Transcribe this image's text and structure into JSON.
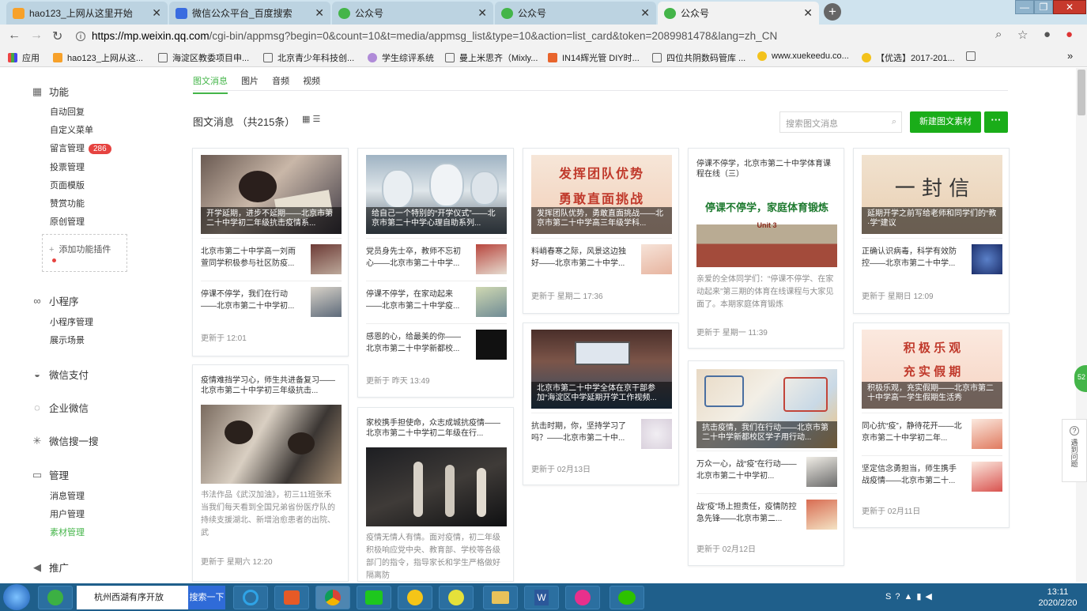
{
  "browser": {
    "tabs": [
      {
        "label": "hao123_上网从这里开始",
        "active": false
      },
      {
        "label": "微信公众平台_百度搜索",
        "active": false
      },
      {
        "label": "公众号",
        "active": false
      },
      {
        "label": "公众号",
        "active": false
      },
      {
        "label": "公众号",
        "active": true
      }
    ],
    "url_host": "https://mp.weixin.qq.com",
    "url_rest": "/cgi-bin/appmsg?begin=0&count=10&t=media/appmsg_list&type=10&action=list_card&token=2089981478&lang=zh_CN",
    "bookmarks": [
      "应用",
      "hao123_上网从这...",
      "海淀区教委项目申...",
      "北京青少年科技创...",
      "学生综评系统",
      "曼上米思齐（Mixly...",
      "IN14辉光管 DIY时...",
      "四位共阴数码管库 ...",
      "www.xuekeedu.co...",
      "【优选】2017-201..."
    ],
    "bookmarks_more": "»"
  },
  "sidebar": {
    "sections": [
      {
        "label": "功能",
        "icon": "grid-icon",
        "items": [
          {
            "label": "自动回复"
          },
          {
            "label": "自定义菜单"
          },
          {
            "label": "留言管理",
            "badge": "286"
          },
          {
            "label": "投票管理"
          },
          {
            "label": "页面模版"
          },
          {
            "label": "赞赏功能"
          },
          {
            "label": "原创管理"
          }
        ]
      },
      {
        "label": "小程序",
        "icon": "link-icon",
        "items": [
          {
            "label": "小程序管理"
          },
          {
            "label": "展示场景"
          }
        ]
      },
      {
        "label": "微信支付",
        "icon": "pay-icon",
        "items": []
      },
      {
        "label": "企业微信",
        "icon": "work-icon",
        "items": []
      },
      {
        "label": "微信搜一搜",
        "icon": "search-star-icon",
        "items": []
      },
      {
        "label": "管理",
        "icon": "manage-icon",
        "items": [
          {
            "label": "消息管理"
          },
          {
            "label": "用户管理"
          },
          {
            "label": "素材管理"
          }
        ]
      },
      {
        "label": "推广",
        "icon": "promo-icon",
        "items": []
      }
    ],
    "plugin_label": "添加功能插件",
    "active_item": "素材管理"
  },
  "main": {
    "tabs": [
      "图文消息",
      "图片",
      "音频",
      "视频"
    ],
    "page_title": "图文消息 （共215条）",
    "search_placeholder": "搜索图文消息",
    "new_button": "新建图文素材",
    "more_button": "···"
  },
  "cards": [
    {
      "cover": "开学延期，进步不延期——北京市第二十中学初二年级抗击疫情系...",
      "items": [
        "北京市第二十中学高一刘雨萱同学积极参与社区防疫...",
        "停课不停学，我们在行动——北京市第二十中学初..."
      ],
      "updated": "更新于 12:01"
    },
    {
      "title": "疫情难挡学习心，师生共进备复习——北京市第二十中学初三年级抗击...",
      "desc": "书法作品《武汉加油》，初三11班张禾 当我们每天看到全国兄弟省份医疗队的持续支援湖北、新增治愈患者的出院、武",
      "updated": "更新于 星期六 12:20"
    },
    {
      "cover": "给自己一个特别的“开学仪式”——北京市第二十中学心理自助系列...",
      "items": [
        "党员身先士卒，教师不忘初心——北京市第二十中学...",
        "停课不停学，在家动起来——北京市第二十中学疫...",
        "感恩的心，给最美的你——北京市第二十中学新都校..."
      ],
      "updated": "更新于 昨天 13:49"
    },
    {
      "title": "家校携手担使命，众志成城抗疫情——北京市第二十中学初二年级在行...",
      "desc": "疫情无情人有情。面对疫情，初二年级积极响应党中央、教育部、学校等各级部门的指令，指导家长和学生严格做好隔离防",
      "updated": ""
    },
    {
      "cover": "发挥团队优势，勇敢直面挑战——北京市第二十中学高三年级学科...",
      "cover_text": [
        "发挥团队优势",
        "勇敢直面挑战"
      ],
      "items": [
        "料峭春寒之际，风景这边独好——北京市第二十中学..."
      ],
      "updated": "更新于 星期二 17:36"
    },
    {
      "cover": "北京市第二十中学全体在京干部参加“海淀区中学延期开学工作视频...",
      "items": [
        "抗击时期，你，坚持学习了吗？——北京市第二十中..."
      ],
      "updated": "更新于 02月13日"
    },
    {
      "title": "停课不停学，北京市第二十中学体育课程在线（三）",
      "pic_text": "停课不停学，家庭体育锻炼",
      "pic_sub": "Unit 3",
      "desc": "亲爱的全体同学们：“停课不停学、在家动起来”第三期的体育在线课程与大家见面了。本期家庭体育锻炼",
      "updated": "更新于 星期一 11:39"
    },
    {
      "cover": "抗击疫情，我们在行动——北京市第二十中学新都校区学子用行动...",
      "items": [
        "万众一心，战“疫”在行动——北京市第二十中学初...",
        "战“疫”场上担责任，疫情防控急先锋——北京市第二..."
      ],
      "updated": "更新于 02月12日"
    },
    {
      "cover": "延期开学之前写给老师和同学们的“教·学”建议",
      "cover_text": [
        "一 封 信"
      ],
      "items": [
        "正确认识病毒，科学有效防控——北京市第二十中学..."
      ],
      "updated": "更新于 星期日 12:09"
    },
    {
      "cover": "积极乐观，充实假期——北京市第二十中学高一学生假期生活秀",
      "cover_text": [
        "积 极 乐 观",
        "充 实 假 期"
      ],
      "items": [
        "同心抗“疫”，静待花开——北京市第二十中学初二年...",
        "坚定信念勇担当，师生携手战疫情——北京市第二十..."
      ],
      "updated": "更新于 02月11日"
    }
  ],
  "float": {
    "badge": "52",
    "help": "遇到问题"
  },
  "taskbar": {
    "search_text": "杭州西湖有序开放",
    "search_button": "搜索一下",
    "time": "13:11",
    "date": "2020/2/20"
  }
}
